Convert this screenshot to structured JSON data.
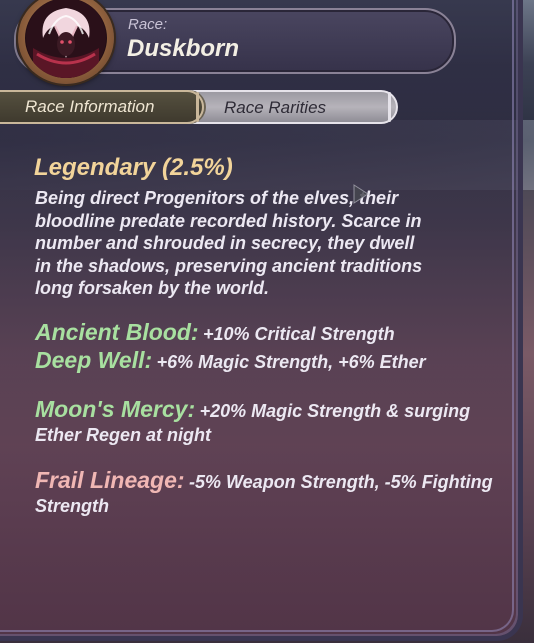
{
  "header": {
    "race_label": "Race:",
    "race_name": "Duskborn"
  },
  "tabs": [
    {
      "label": "Race Information",
      "active": true
    },
    {
      "label": "Race Rarities",
      "active": false
    }
  ],
  "content": {
    "rarity": "Legendary (2.5%)",
    "description_lines": [
      "Being direct Progenitors of the elves, their",
      "bloodline predate recorded history. Scarce in",
      "number and shrouded in secrecy, they dwell",
      "in the shadows, preserving ancient traditions",
      "long forsaken by the world."
    ],
    "traits": [
      {
        "name": "Ancient Blood:",
        "desc": "+10% Critical Strength",
        "color": "#a8e0a0"
      },
      {
        "name": "Deep Well:",
        "desc": "+6% Magic Strength, +6% Ether",
        "color": "#a8e0a0"
      },
      {
        "name": "Moon's Mercy:",
        "desc": "+20% Magic Strength & surging Ether Regen at night",
        "color": "#a8e0a0"
      },
      {
        "name": "Frail Lineage:",
        "desc": "-5% Weapon Strength, -5% Fighting Strength",
        "color": "#f0b7b4"
      }
    ]
  },
  "colors": {
    "rarity_gold": "#f2d49a",
    "buff_green": "#a8e0a0",
    "debuff_pink": "#f0b7b4"
  },
  "icons": [
    "race-avatar-portrait",
    "cursor-arrow-icon"
  ]
}
